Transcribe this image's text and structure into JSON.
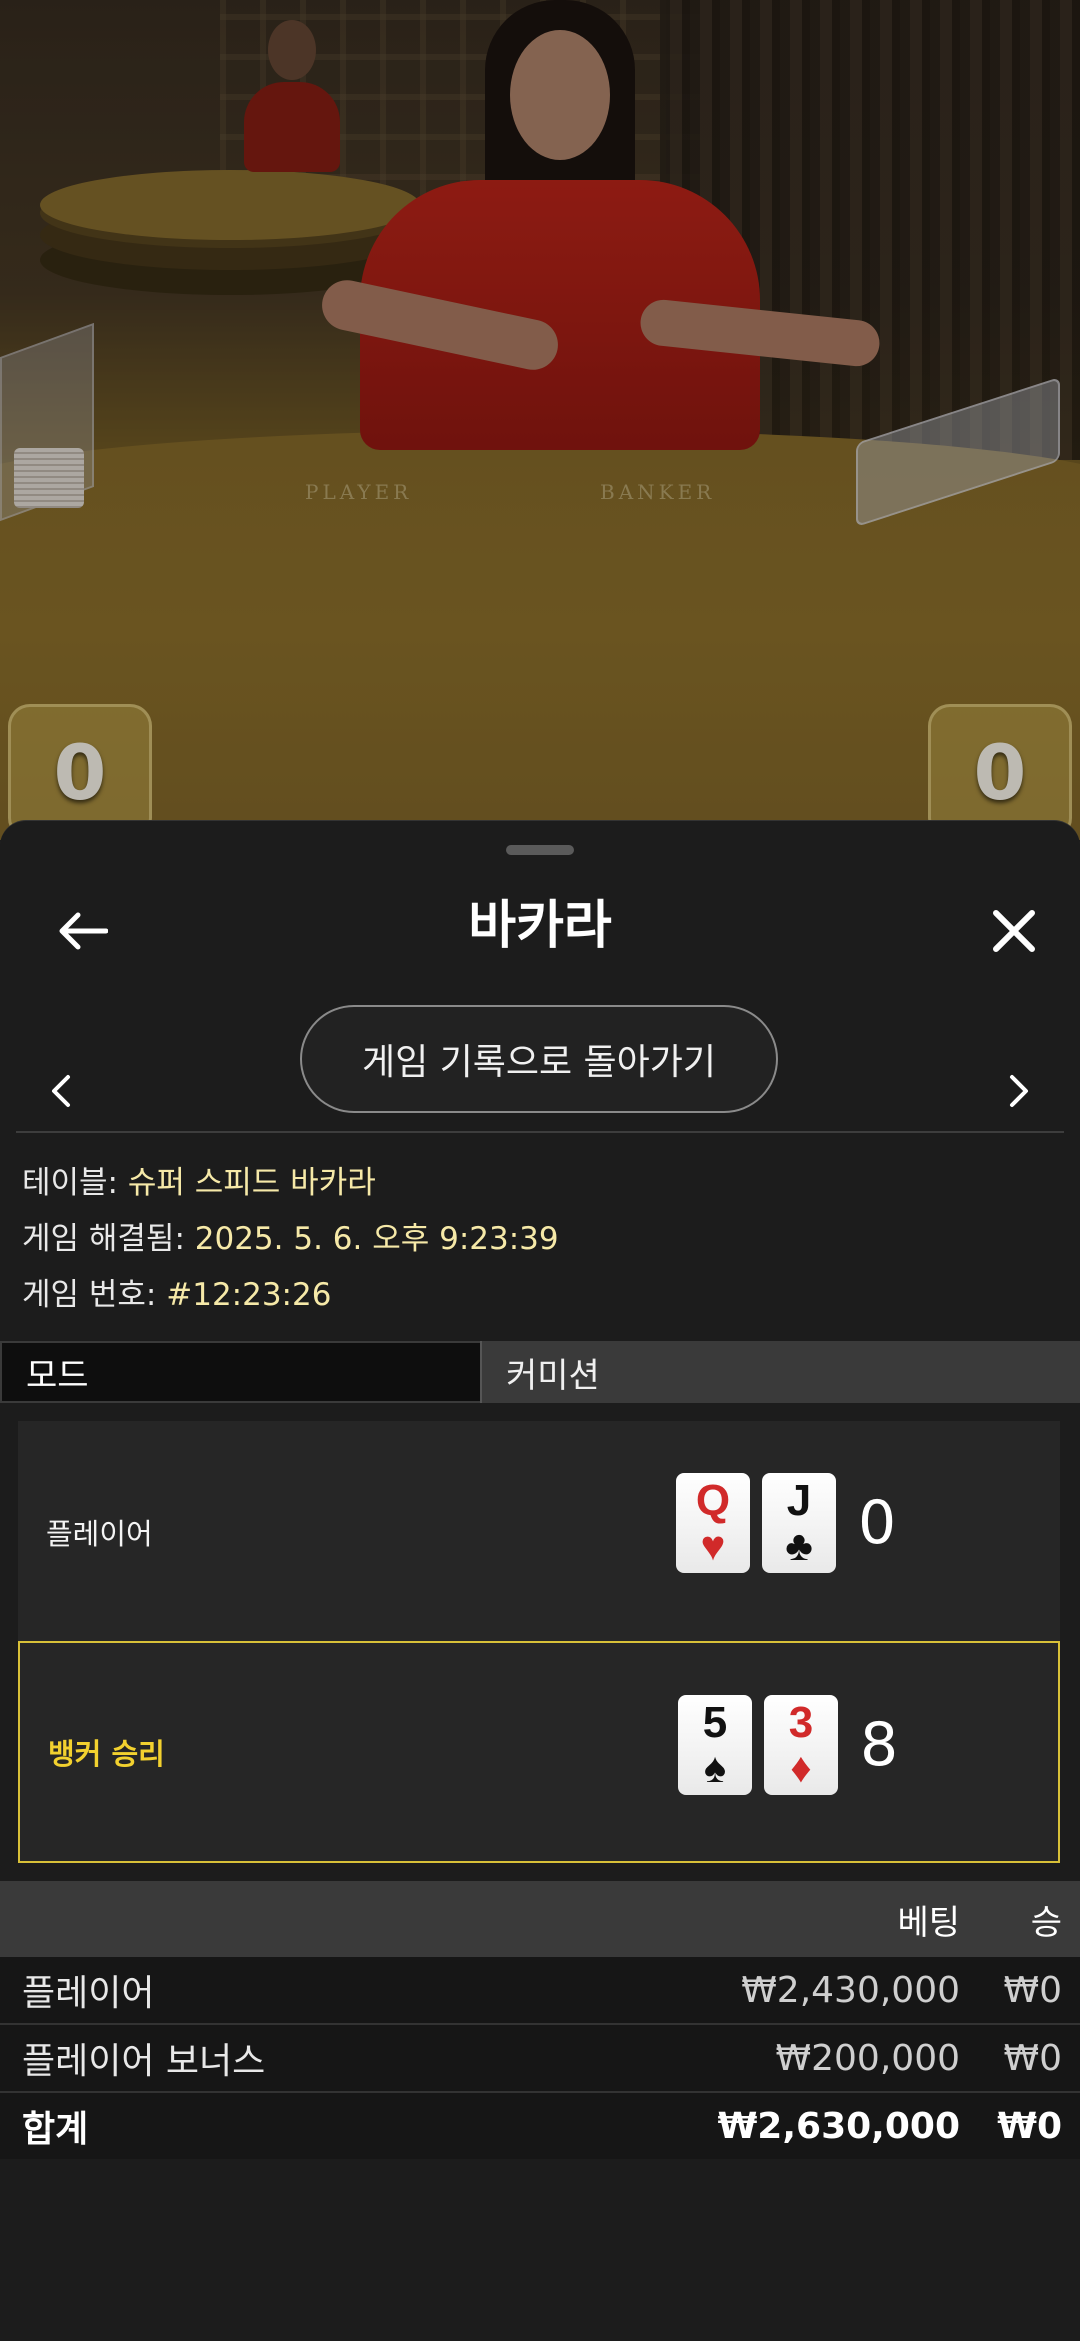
{
  "video": {
    "player_felt_label": "PLAYER",
    "banker_felt_label": "BANKER",
    "player_score_chip": "0",
    "banker_score_chip": "0"
  },
  "sheet": {
    "title": "바카라",
    "back_icon": "arrow-left-icon",
    "close_icon": "close-icon",
    "history_button": "게임 기록으로 돌아가기",
    "meta": {
      "table_label": "테이블:",
      "table_value": "슈퍼 스피드 바카라",
      "resolved_label": "게임 해결됨:",
      "resolved_value": "2025. 5. 6. 오후 9:23:39",
      "number_label": "게임 번호:",
      "number_value": "#12:23:26"
    },
    "tabs": {
      "mode": "모드",
      "commission": "커미션"
    },
    "results": {
      "player": {
        "label": "플레이어",
        "cards": [
          {
            "rank": "Q",
            "suit": "♥"
          },
          {
            "rank": "J",
            "suit": "♣"
          }
        ],
        "score": "0"
      },
      "banker": {
        "label": "뱅커 승리",
        "cards": [
          {
            "rank": "5",
            "suit": "♠"
          },
          {
            "rank": "3",
            "suit": "♦"
          }
        ],
        "score": "8"
      }
    },
    "bets": {
      "header_bet": "베팅",
      "header_win": "승",
      "rows": [
        {
          "name": "플레이어",
          "bet": "₩2,430,000",
          "win": "₩0"
        },
        {
          "name": "플레이어 보너스",
          "bet": "₩200,000",
          "win": "₩0"
        }
      ],
      "total": {
        "name": "합계",
        "bet": "₩2,630,000",
        "win": "₩0"
      }
    },
    "colors": {
      "accent_yellow": "#f2d12f",
      "value_cream": "#f6e9a8",
      "card_red": "#d12a2a"
    }
  }
}
